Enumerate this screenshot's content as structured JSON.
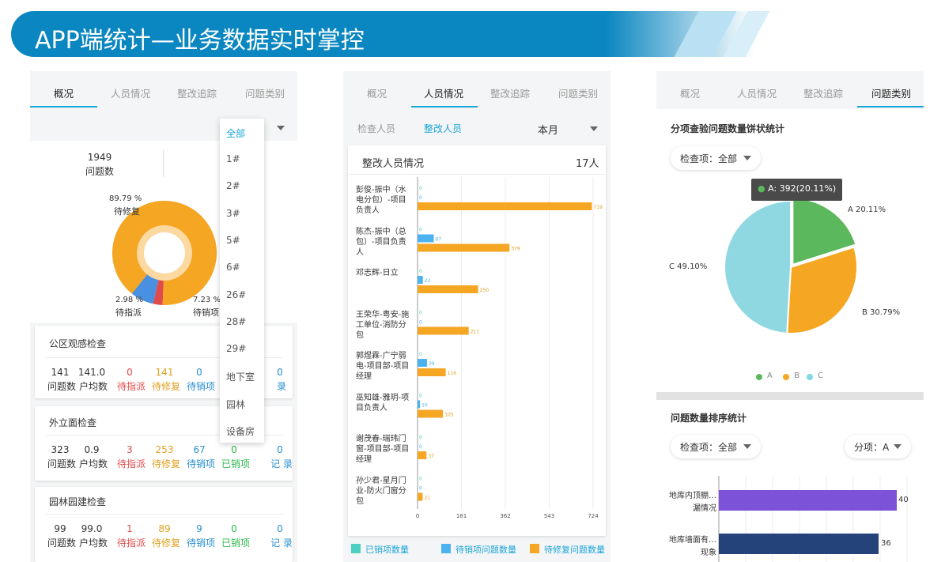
{
  "banner": {
    "title": "APP端统计—业务数据实时掌控"
  },
  "colors": {
    "accent": "#1aa5d8",
    "orange": "#f5a623",
    "blue": "#4a90e2",
    "red": "#e04b4b",
    "green": "#2db84d",
    "teal": "#4dd0c1"
  },
  "panel1": {
    "tabs": [
      "概况",
      "人员情况",
      "整改追踪",
      "问题类别"
    ],
    "active_tab": 0,
    "summary": {
      "count": "1949",
      "count_label": "问题数",
      "right_partial": "i"
    },
    "donut": {
      "segments": [
        {
          "label": "待修复",
          "percent": "89.79 %",
          "value": 89.79,
          "color": "#f5a623"
        },
        {
          "label": "待销项",
          "percent": "7.23 %",
          "value": 7.23,
          "color": "#4a90e2"
        },
        {
          "label": "待指派",
          "percent": "2.98 %",
          "value": 2.98,
          "color": "#e04b4b"
        }
      ]
    },
    "dropdown": [
      "全部",
      "1#",
      "2#",
      "3#",
      "5#",
      "6#",
      "26#",
      "28#",
      "29#",
      "地下室",
      "园林",
      "设备房"
    ],
    "cards": [
      {
        "title": "公区观感检查",
        "values": [
          "141",
          "141.0",
          "0",
          "141",
          "0",
          "",
          "0"
        ],
        "labels": [
          "问题数",
          "户均数",
          "待指派",
          "待修复",
          "待销项",
          "",
          "录"
        ]
      },
      {
        "title": "外立面检查",
        "values": [
          "323",
          "0.9",
          "3",
          "253",
          "67",
          "0",
          "0"
        ],
        "labels": [
          "问题数",
          "户均数",
          "待指派",
          "待修复",
          "待销项",
          "已销项",
          "记 录"
        ]
      },
      {
        "title": "园林园建检查",
        "values": [
          "99",
          "99.0",
          "1",
          "89",
          "9",
          "0",
          "0"
        ],
        "labels": [
          "问题数",
          "户均数",
          "待指派",
          "待修复",
          "待销项",
          "已销项",
          "记 录"
        ]
      }
    ]
  },
  "panel2": {
    "tabs": [
      "概况",
      "人员情况",
      "整改追踪",
      "问题类别"
    ],
    "active_tab": 1,
    "subtabs": [
      "检查人员",
      "整改人员"
    ],
    "period": "本月",
    "card_title": "整改人员情况",
    "card_count": "17人",
    "x_ticks": [
      "0",
      "181",
      "362",
      "543",
      "724"
    ],
    "legend": [
      {
        "label": "已销项数量",
        "color": "#4dd0c1"
      },
      {
        "label": "待销项问题数量",
        "color": "#4db3f0"
      },
      {
        "label": "待修复问题数量",
        "color": "#f5a623"
      }
    ]
  },
  "chart_data": [
    {
      "type": "bar",
      "title": "整改人员情况",
      "categories": [
        "彭俊-振中（水电分包）-项目负责人",
        "陈杰-振中（总包）-项目负责人",
        "邓志辉-日立",
        "王荣华-粤安-施工单位-消防分包",
        "郭煜霖-广宁弱电-项目部-项目经理",
        "巫知雄-雅玥-项目负责人",
        "谢茂春-瑞玮门窗-项目部-项目经理",
        "孙少君-星月门业-防火门窗分包"
      ],
      "series": [
        {
          "name": "已销项数量",
          "values": [
            0,
            0,
            0,
            0,
            0,
            0,
            0,
            0
          ]
        },
        {
          "name": "待销项问题数量",
          "values": [
            0,
            67,
            22,
            0,
            39,
            10,
            0,
            0
          ]
        },
        {
          "name": "待修复问题数量",
          "values": [
            719,
            379,
            250,
            211,
            116,
            105,
            37,
            21
          ]
        }
      ],
      "xlim": [
        0,
        724
      ]
    },
    {
      "type": "pie",
      "title": "分项查验问题数量饼状统计",
      "categories": [
        "A",
        "B",
        "C"
      ],
      "values": [
        20.11,
        30.79,
        49.1
      ],
      "labels": [
        "A 20.11%",
        "B 30.79%",
        "C 49.10%"
      ],
      "tooltip": "A: 392(20.11%)",
      "legend": "bottom"
    },
    {
      "type": "bar",
      "title": "问题数量排序统计",
      "categories": [
        "地库内顶棚...漏情况",
        "地库墙面有...现象"
      ],
      "values": [
        40,
        36
      ]
    }
  ],
  "panel2_bars": {
    "names": [
      [
        "彭俊-振中（水",
        "电分包）-项目",
        "负责人"
      ],
      [
        "陈杰-振中（总",
        "包）-项目负责",
        "人"
      ],
      [
        "邓志辉-日立"
      ],
      [
        "王荣华-粤安-施",
        "工单位-消防分",
        "包"
      ],
      [
        "郭煜霖-广宁弱",
        "电-项目部-项目",
        "经理"
      ],
      [
        "巫知雄-雅玥-项",
        "目负责人"
      ],
      [
        "谢茂春-瑞玮门",
        "窗-项目部-项目",
        "经理"
      ],
      [
        "孙少君-星月门",
        "业-防火门窗分",
        "包"
      ]
    ],
    "labels_a": [
      "0",
      "0",
      "0",
      "0",
      "0",
      "0",
      "0",
      "0"
    ],
    "labels_b": [
      "0",
      "67",
      "22",
      "0",
      "39",
      "10",
      "0",
      "0"
    ],
    "labels_c": [
      "719",
      "379",
      "250",
      "211",
      "116",
      "105",
      "37",
      "21"
    ]
  },
  "panel3": {
    "tabs": [
      "概况",
      "人员情况",
      "整改追踪",
      "问题类别"
    ],
    "active_tab": 3,
    "pie_title": "分项查验问题数量饼状统计",
    "filter1": "检查项：全部",
    "tooltip": "A: 392(20.11%)",
    "legend": [
      "A",
      "B",
      "C"
    ],
    "rank_title": "问题数量排序统计",
    "filter2": "检查项：全部",
    "filter3": "分项：A",
    "rank_items": [
      {
        "name1": "地库内顶棚…",
        "name2": "漏情况",
        "value": "40",
        "color": "#7b52d8"
      },
      {
        "name1": "地库墙面有…",
        "name2": "现象",
        "value": "36",
        "color": "#23437a"
      }
    ]
  }
}
